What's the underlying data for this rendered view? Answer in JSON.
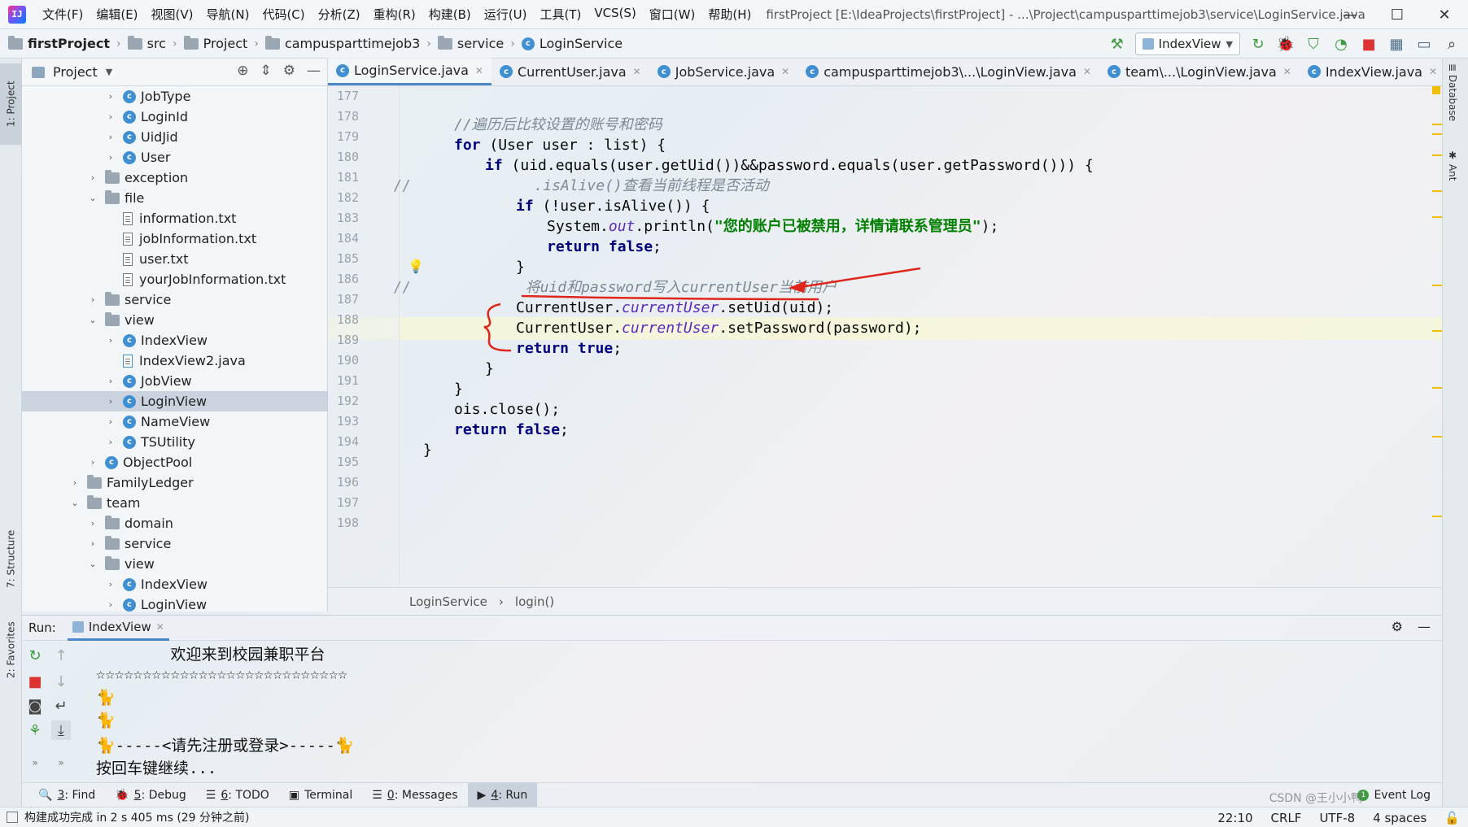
{
  "menu": {
    "items": [
      "文件(F)",
      "编辑(E)",
      "视图(V)",
      "导航(N)",
      "代码(C)",
      "分析(Z)",
      "重构(R)",
      "构建(B)",
      "运行(U)",
      "工具(T)",
      "VCS(S)",
      "窗口(W)",
      "帮助(H)"
    ],
    "window_title": "firstProject [E:\\IdeaProjects\\firstProject] - ...\\Project\\campusparttimejob3\\service\\LoginService.java"
  },
  "navbar": {
    "crumbs": [
      "firstProject",
      "src",
      "Project",
      "campusparttimejob3",
      "service",
      "LoginService"
    ],
    "run_config": "IndexView"
  },
  "project_panel": {
    "title": "Project",
    "tree": [
      {
        "label": "JobType",
        "kind": "class",
        "indent": 2,
        "arrow": "›"
      },
      {
        "label": "LoginId",
        "kind": "class",
        "indent": 2,
        "arrow": "›"
      },
      {
        "label": "UidJid",
        "kind": "class",
        "indent": 2,
        "arrow": "›"
      },
      {
        "label": "User",
        "kind": "class",
        "indent": 2,
        "arrow": "›"
      },
      {
        "label": "exception",
        "kind": "folder",
        "indent": 1,
        "arrow": "›"
      },
      {
        "label": "file",
        "kind": "folder",
        "indent": 1,
        "arrow": "⌄"
      },
      {
        "label": "information.txt",
        "kind": "txt",
        "indent": 2,
        "arrow": ""
      },
      {
        "label": "jobInformation.txt",
        "kind": "txt",
        "indent": 2,
        "arrow": ""
      },
      {
        "label": "user.txt",
        "kind": "txt",
        "indent": 2,
        "arrow": ""
      },
      {
        "label": "yourJobInformation.txt",
        "kind": "txt",
        "indent": 2,
        "arrow": ""
      },
      {
        "label": "service",
        "kind": "folder",
        "indent": 1,
        "arrow": "›"
      },
      {
        "label": "view",
        "kind": "folder",
        "indent": 1,
        "arrow": "⌄"
      },
      {
        "label": "IndexView",
        "kind": "class",
        "indent": 2,
        "arrow": "›"
      },
      {
        "label": "IndexView2.java",
        "kind": "java",
        "indent": 2,
        "arrow": ""
      },
      {
        "label": "JobView",
        "kind": "class",
        "indent": 2,
        "arrow": "›"
      },
      {
        "label": "LoginView",
        "kind": "class",
        "indent": 2,
        "arrow": "›",
        "selected": true
      },
      {
        "label": "NameView",
        "kind": "class",
        "indent": 2,
        "arrow": "›"
      },
      {
        "label": "TSUtility",
        "kind": "class",
        "indent": 2,
        "arrow": "›"
      },
      {
        "label": "ObjectPool",
        "kind": "class",
        "indent": 1,
        "arrow": "›"
      },
      {
        "label": "FamilyLedger",
        "kind": "folder",
        "indent": 0,
        "arrow": "›"
      },
      {
        "label": "team",
        "kind": "folder",
        "indent": 0,
        "arrow": "⌄"
      },
      {
        "label": "domain",
        "kind": "folder",
        "indent": 1,
        "arrow": "›"
      },
      {
        "label": "service",
        "kind": "folder",
        "indent": 1,
        "arrow": "›"
      },
      {
        "label": "view",
        "kind": "folder",
        "indent": 1,
        "arrow": "⌄"
      },
      {
        "label": "IndexView",
        "kind": "class",
        "indent": 2,
        "arrow": "›"
      },
      {
        "label": "LoginView",
        "kind": "class",
        "indent": 2,
        "arrow": "›"
      }
    ]
  },
  "editor_tabs": [
    {
      "label": "LoginService.java",
      "active": true
    },
    {
      "label": "CurrentUser.java"
    },
    {
      "label": "JobService.java"
    },
    {
      "label": "campusparttimejob3\\...\\LoginView.java"
    },
    {
      "label": "team\\...\\LoginView.java"
    },
    {
      "label": "IndexView.java"
    }
  ],
  "editor": {
    "line_numbers": [
      "177",
      "178",
      "179",
      "180",
      "181",
      "182",
      "183",
      "184",
      "185",
      "186",
      "187",
      "188",
      "189",
      "190",
      "191",
      "192",
      "193",
      "194",
      "195",
      "196",
      "197",
      "198"
    ],
    "breadcrumb": [
      "LoginService",
      "login()"
    ]
  },
  "right_stripe": [
    "Database",
    "Ant"
  ],
  "left_stripe": [
    "1: Project",
    "7: Structure",
    "2: Favorites"
  ],
  "run": {
    "label": "Run:",
    "tab": "IndexView",
    "console": [
      "        欢迎来到校园兼职平台",
      "☆☆☆☆☆☆☆☆☆☆☆☆☆☆☆☆☆☆☆☆☆☆☆☆☆☆☆",
      "🐈",
      "🐈",
      "🐈-----<请先注册或登录>-----🐈",
      "按回车键继续..."
    ]
  },
  "bottom_tabs": [
    {
      "key": "3",
      "label": ": Find",
      "icon": "🔍"
    },
    {
      "key": "5",
      "label": ": Debug",
      "icon": "🐞"
    },
    {
      "key": "6",
      "label": ": TODO",
      "icon": "☰"
    },
    {
      "key": "",
      "label": "Terminal",
      "icon": "▣"
    },
    {
      "key": "0",
      "label": ": Messages",
      "icon": "☰"
    },
    {
      "key": "4",
      "label": ": Run",
      "icon": "▶",
      "active": true
    }
  ],
  "event_log": "Event Log",
  "status": {
    "message": "构建成功完成 in 2 s 405 ms (29 分钟之前)",
    "position": "22:10",
    "line_sep": "CRLF",
    "encoding": "UTF-8",
    "indent": "4 spaces",
    "watermark": "CSDN @王小小鸭"
  },
  "colors": {
    "accent": "#4a88c7",
    "annotation_red": "#e0261b",
    "keyword": "#00007f",
    "string": "#007f00",
    "comment": "#7b8a94"
  }
}
